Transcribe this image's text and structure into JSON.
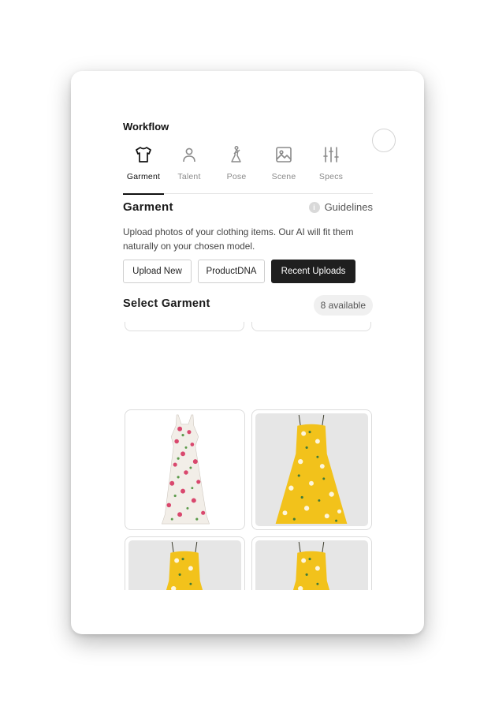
{
  "workflow": {
    "title": "Workflow",
    "tabs": [
      {
        "label": "Garment",
        "icon": "shirt-icon",
        "active": true
      },
      {
        "label": "Talent",
        "icon": "person-icon",
        "active": false
      },
      {
        "label": "Pose",
        "icon": "pose-icon",
        "active": false
      },
      {
        "label": "Scene",
        "icon": "image-icon",
        "active": false
      },
      {
        "label": "Specs",
        "icon": "sliders-icon",
        "active": false
      }
    ]
  },
  "garment": {
    "title": "Garment",
    "guidelines_label": "Guidelines",
    "guidelines_icon": "info-icon",
    "description": "Upload photos of your clothing items. Our AI will fit them naturally on your chosen model.",
    "buttons": {
      "upload_new": "Upload New",
      "product_dna": "ProductDNA",
      "recent_uploads": "Recent Uploads"
    }
  },
  "select": {
    "title": "Select Garment",
    "available": "8 available",
    "items": [
      {
        "name": "floral-rose-maxi-dress",
        "background": "white"
      },
      {
        "name": "yellow-floral-sundress",
        "background": "grey"
      },
      {
        "name": "yellow-floral-sundress",
        "background": "grey"
      },
      {
        "name": "yellow-floral-sundress",
        "background": "grey"
      }
    ]
  },
  "colors": {
    "active": "#111111",
    "inactive": "#8a8a8a",
    "primary_button": "#1f1f1f",
    "dress_yellow": "#f2c21b",
    "tile_grey": "#e6e6e6"
  }
}
